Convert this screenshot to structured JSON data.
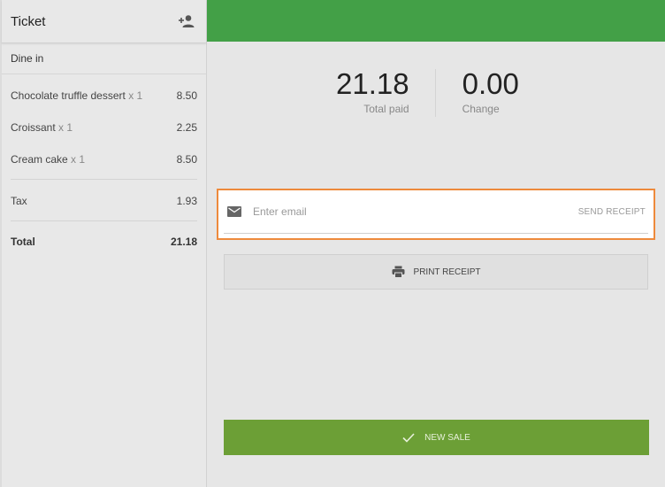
{
  "ticket": {
    "title": "Ticket",
    "add_customer_icon": "person-add-icon",
    "dining_option": "Dine in",
    "items": [
      {
        "name": "Chocolate truffle dessert",
        "qty": "x 1",
        "price": "8.50"
      },
      {
        "name": "Croissant",
        "qty": "x 1",
        "price": "2.25"
      },
      {
        "name": "Cream cake",
        "qty": "x 1",
        "price": "8.50"
      }
    ],
    "tax_label": "Tax",
    "tax_value": "1.93",
    "total_label": "Total",
    "total_value": "21.18"
  },
  "payment": {
    "total_paid": "21.18",
    "total_paid_label": "Total paid",
    "change": "0.00",
    "change_label": "Change"
  },
  "receipt": {
    "email_placeholder": "Enter email",
    "email_value": "",
    "send_label": "SEND RECEIPT",
    "print_label": "PRINT RECEIPT",
    "new_sale_label": "NEW SALE"
  },
  "colors": {
    "topbar": "#43a047",
    "new_sale": "#6c9f36",
    "highlight": "#ee8a3c"
  }
}
